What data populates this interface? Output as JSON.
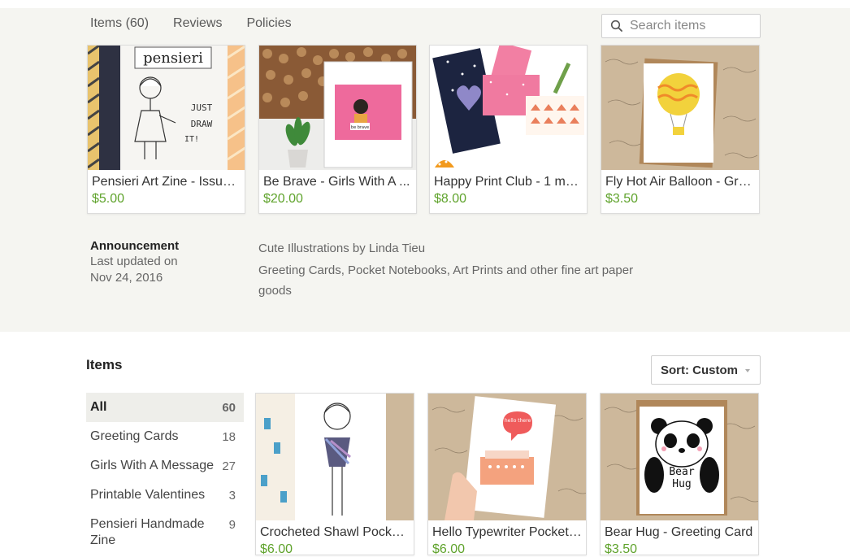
{
  "tabs": [
    {
      "label": "Items (60)"
    },
    {
      "label": "Reviews"
    },
    {
      "label": "Policies"
    }
  ],
  "search": {
    "placeholder": "Search items"
  },
  "featured": [
    {
      "title": "Pensieri Art Zine - Issue ...",
      "price": "$5.00"
    },
    {
      "title": "Be Brave - Girls With A ...",
      "price": "$20.00"
    },
    {
      "title": "Happy Print Club - 1 mo...",
      "price": "$8.00"
    },
    {
      "title": "Fly Hot Air Balloon - Gre...",
      "price": "$3.50"
    }
  ],
  "thumb_text": {
    "zine_title": "pensieri",
    "zine_line1": "JUST",
    "zine_line2": "DRAW",
    "zine_line3": "IT!",
    "brave_label": "be brave",
    "typewriter_bubble": "hello there",
    "bear_line1": "Bear",
    "bear_line2": "Hug"
  },
  "announcement": {
    "heading": "Announcement",
    "updated": "Last updated on Nov 24, 2016",
    "title": "Cute Illustrations by Linda Tieu",
    "body": "Greeting Cards, Pocket Notebooks, Art Prints and other fine art paper goods"
  },
  "items_section": {
    "heading": "Items",
    "sort_label": "Sort: Custom"
  },
  "categories": [
    {
      "name": "All",
      "count": "60"
    },
    {
      "name": "Greeting Cards",
      "count": "18"
    },
    {
      "name": "Girls With A Message",
      "count": "27"
    },
    {
      "name": "Printable Valentines",
      "count": "3"
    },
    {
      "name": "Pensieri Handmade Zine",
      "count": "9"
    }
  ],
  "listings": [
    {
      "title": "Crocheted Shawl Pocke...",
      "price": "$6.00"
    },
    {
      "title": "Hello Typewriter Pocket ...",
      "price": "$6.00"
    },
    {
      "title": "Bear Hug - Greeting Card",
      "price": "$3.50"
    }
  ],
  "colors": {
    "price": "#5fa32c",
    "band": "#f5f5f1",
    "active_category": "#eeeeea"
  }
}
